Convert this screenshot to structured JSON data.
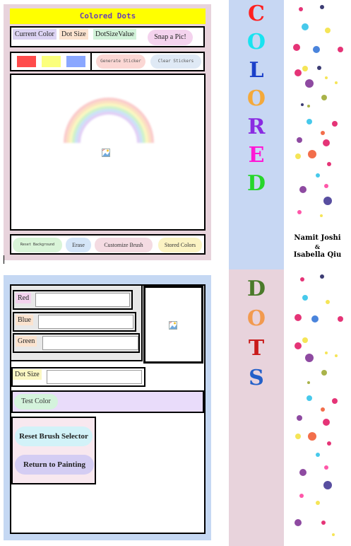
{
  "app": {
    "title": "Colored Dots"
  },
  "toolbar": {
    "current_color_label": "Current Color",
    "dot_size_label": "Dot Size",
    "dot_size_value_label": "DotSizeValue",
    "snap_label": "Snap a Pic!"
  },
  "palette": {
    "swatches": [
      {
        "name": "red",
        "color": "#ff4b4b"
      },
      {
        "name": "yellow",
        "color": "#fbff7c"
      },
      {
        "name": "blue",
        "color": "#8aa7ff"
      }
    ],
    "generate_label": "Generate Sticker",
    "clear_label": "Clear Stickers"
  },
  "tools": {
    "reset_background_label": "Reset Background",
    "erase_label": "Erase",
    "customize_label": "Customize Brush",
    "stored_label": "Stored Colors"
  },
  "brush_editor": {
    "red_label": "Red",
    "blue_label": "Blue",
    "green_label": "Green",
    "red_value": "",
    "blue_value": "",
    "green_value": "",
    "dot_size_label": "Dot Size",
    "dot_size_value": "",
    "test_label": "Test Color",
    "reset_label": "Reset Brush Selector",
    "return_label": "Return to Painting"
  },
  "banner": {
    "colored_letters": [
      {
        "char": "C",
        "color": "#ff2020"
      },
      {
        "char": "O",
        "color": "#19e3f0"
      },
      {
        "char": "L",
        "color": "#1b40c9"
      },
      {
        "char": "O",
        "color": "#f4a93a"
      },
      {
        "char": "R",
        "color": "#8a2be2"
      },
      {
        "char": "E",
        "color": "#ff18d6"
      },
      {
        "char": "D",
        "color": "#27d62b"
      }
    ],
    "dots_letters": [
      {
        "char": "D",
        "color": "#4a7a2a"
      },
      {
        "char": "O",
        "color": "#f29a4f"
      },
      {
        "char": "T",
        "color": "#c91b1b"
      },
      {
        "char": "S",
        "color": "#2360c9"
      }
    ],
    "credit_line_1": "Namit Joshi",
    "credit_line_2": "&",
    "credit_line_3": "Isabella Qiu"
  },
  "icons": {
    "image_placeholder": "broken-image-icon",
    "rainbow": "rainbow-sticker"
  }
}
